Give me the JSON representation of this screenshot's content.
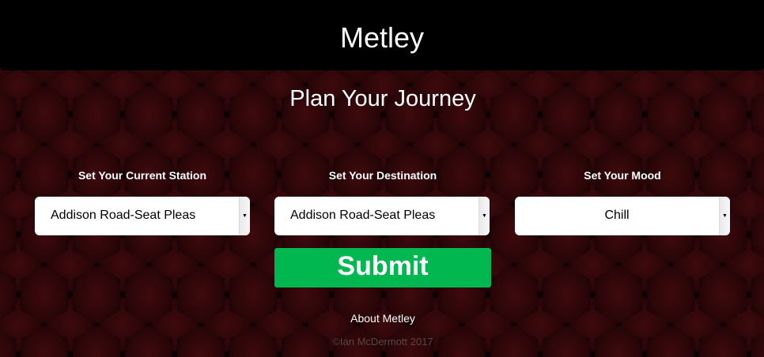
{
  "header": {
    "app_title": "Metley"
  },
  "main": {
    "page_title": "Plan Your Journey",
    "fields": [
      {
        "label": "Set Your Current Station",
        "selected": "Addison Road-Seat Pleas"
      },
      {
        "label": "Set Your Destination",
        "selected": "Addison Road-Seat Pleas"
      },
      {
        "label": "Set Your Mood",
        "selected": "Chill"
      }
    ],
    "submit_label": "Submit"
  },
  "footer": {
    "about_link": "About Metley",
    "copyright": "©Ian McDermott 2017"
  },
  "colors": {
    "header_bg": "#000000",
    "page_bg": "#140405",
    "hex_pattern": "#3a0a0c",
    "submit_bg": "#00b84f",
    "copyright_text": "#5a4646"
  },
  "icons": {
    "select_arrow": "dropdown-arrow-icon"
  }
}
